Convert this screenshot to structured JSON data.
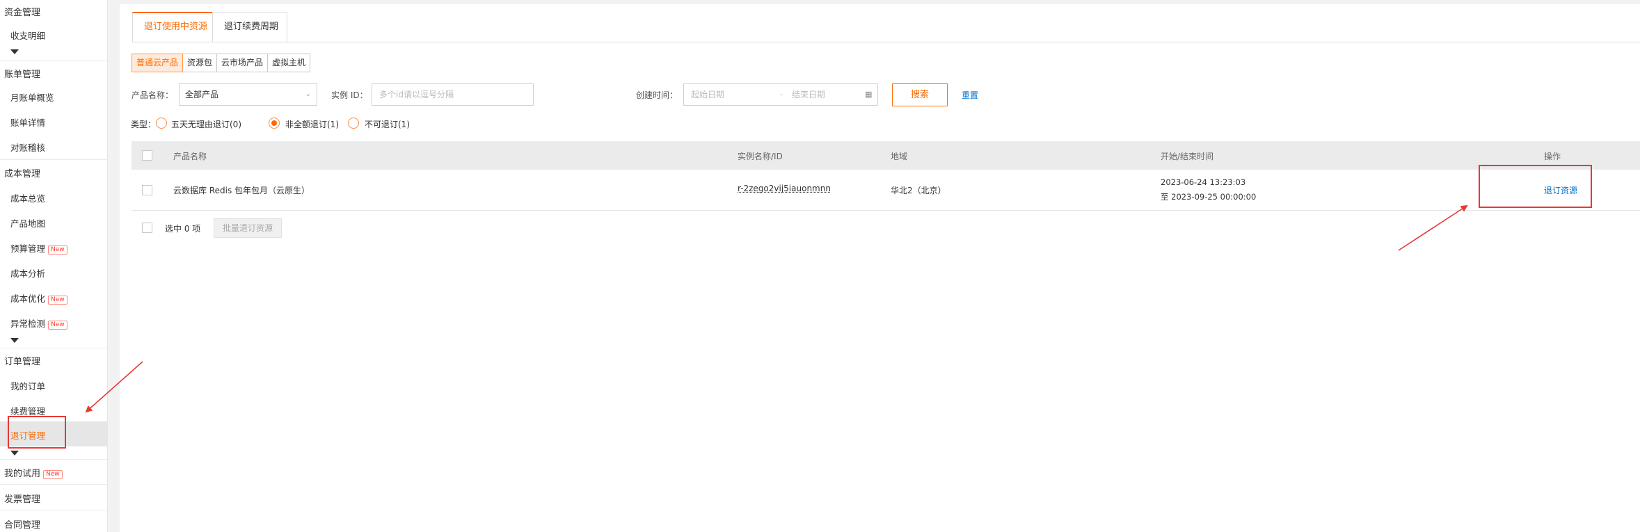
{
  "sidebar": {
    "groups": [
      {
        "title": "资金管理",
        "items": [
          "收支明细"
        ]
      },
      {
        "title": "账单管理",
        "items": [
          "月账单概览",
          "账单详情",
          "对账稽核"
        ]
      },
      {
        "title": "成本管理",
        "items": [
          "成本总览",
          "产品地图",
          "预算管理",
          "成本分析",
          "成本优化",
          "异常检测"
        ]
      },
      {
        "title": "订单管理",
        "items": [
          "我的订单",
          "续费管理",
          "退订管理"
        ]
      },
      {
        "title": "我的试用"
      },
      {
        "title": "发票管理"
      },
      {
        "title": "合同管理"
      }
    ],
    "new_badge": "New",
    "active_item": "退订管理"
  },
  "tabs": [
    "退订使用中资源",
    "退订续费周期"
  ],
  "product_types": [
    "普通云产品",
    "资源包",
    "云市场产品",
    "虚拟主机"
  ],
  "filters": {
    "product_label": "产品名称：",
    "product_value": "全部产品",
    "instance_label": "实例 ID：",
    "instance_placeholder": "多个id请以逗号分隔",
    "created_label": "创建时间：",
    "start_placeholder": "起始日期",
    "range_sep": "-",
    "end_placeholder": "结束日期",
    "search": "搜索",
    "reset": "重置"
  },
  "type_filter": {
    "label": "类型：",
    "options": [
      "五天无理由退订(0)",
      "非全额退订(1)",
      "不可退订(1)"
    ],
    "selected": 1
  },
  "table": {
    "columns": [
      "产品名称",
      "实例名称/ID",
      "地域",
      "开始/结束时间",
      "操作"
    ],
    "rows": [
      {
        "product": "云数据库 Redis 包年包月（云原生）",
        "instance": "r-2zego2vij5iauonmnn",
        "region": "华北2（北京）",
        "start": "2023-06-24 13:23:03",
        "end": "至 2023-09-25 00:00:00",
        "action": "退订资源"
      }
    ]
  },
  "footer": {
    "selected": "选中 0 项",
    "batch": "批量退订资源"
  },
  "colors": {
    "accent": "#ff6a00",
    "link": "#0070cc",
    "annotation": "#e53935"
  },
  "icons": [
    "calendar-icon",
    "chevron-down-icon",
    "caret-down-icon"
  ]
}
